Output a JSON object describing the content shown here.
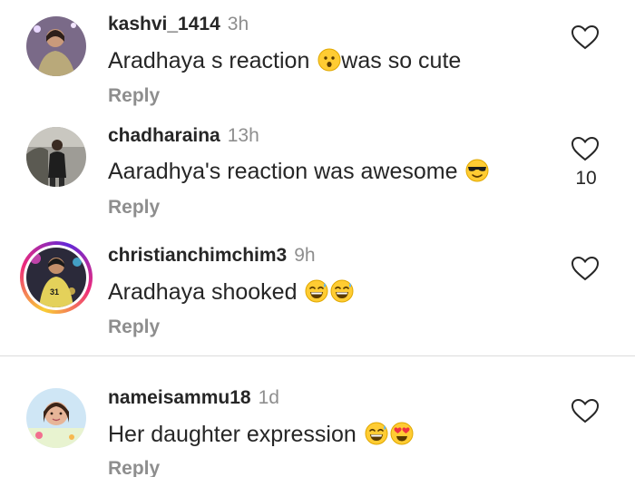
{
  "comments": [
    {
      "username": "kashvi_1414",
      "time": "3h",
      "text": "Aradhaya s reaction ",
      "text_after": "was so cute",
      "emoji": [
        "hushed-face"
      ],
      "reply_label": "Reply",
      "likes": ""
    },
    {
      "username": "chadharaina",
      "time": "13h",
      "text": "Aaradhya's reaction was awesome ",
      "emoji": [
        "sunglasses-face"
      ],
      "reply_label": "Reply",
      "likes": "10"
    },
    {
      "username": "christianchimchim3",
      "time": "9h",
      "text": "Aradhaya shooked ",
      "emoji": [
        "grinning-sweat-face",
        "grinning-sweat-face"
      ],
      "reply_label": "Reply",
      "likes": "",
      "has_story_ring": true
    },
    {
      "username": "nameisammu18",
      "time": "1d",
      "text": "Her daughter expression ",
      "emoji": [
        "grinning-sweat-face",
        "heart-eyes-face"
      ],
      "reply_label": "Reply",
      "likes": ""
    }
  ],
  "colors": {
    "text": "#262626",
    "secondary": "#8e8e8e",
    "divider": "#dbdbdb",
    "emoji_yellow": "#ffcc33"
  }
}
